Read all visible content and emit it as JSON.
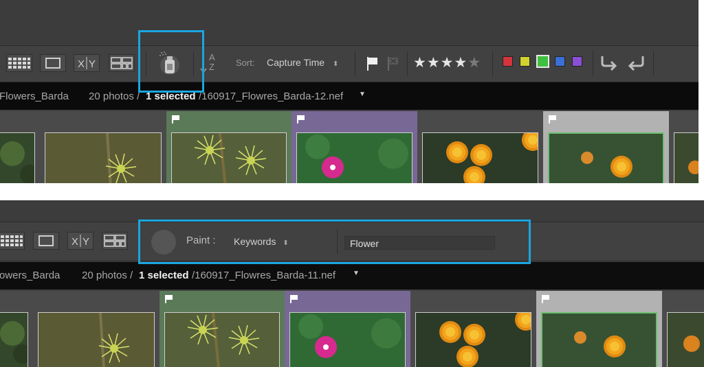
{
  "toolbar": {
    "sort_label": "Sort:",
    "sort_value": "Capture Time",
    "sort_az": "AZ",
    "stars": [
      "★",
      "★",
      "★",
      "★",
      "★"
    ],
    "star_count": 4,
    "color_labels": [
      "#d4343c",
      "#d2d22e",
      "#3fbf3f",
      "#3a6fd8",
      "#8a4fd6"
    ],
    "color_selected": 2
  },
  "paint_bar": {
    "paint_label": "Paint :",
    "mode_value": "Keywords",
    "keyword_value": "Flower"
  },
  "top_info": {
    "folder": "Flowers_Barda",
    "count": "20 photos /",
    "selected": "1 selected",
    "filename": "/160917_Flowres_Barda-12.nef"
  },
  "bottom_info": {
    "folder": "owers_Barda",
    "count": "20 photos /",
    "selected": "1 selected",
    "filename": "/160917_Flowres_Barda-11.nef"
  },
  "icons": {
    "grid": "grid-view-icon",
    "loupe": "loupe-view-icon",
    "compare": "compare-view-icon",
    "survey": "survey-view-icon",
    "painter": "spray-can-painter-icon",
    "flag": "pick-flag-icon",
    "reject": "reject-flag-icon",
    "rotate_left": "rotate-left-icon",
    "rotate_right": "rotate-right-icon"
  },
  "highlight_color": "#1aa6e0"
}
